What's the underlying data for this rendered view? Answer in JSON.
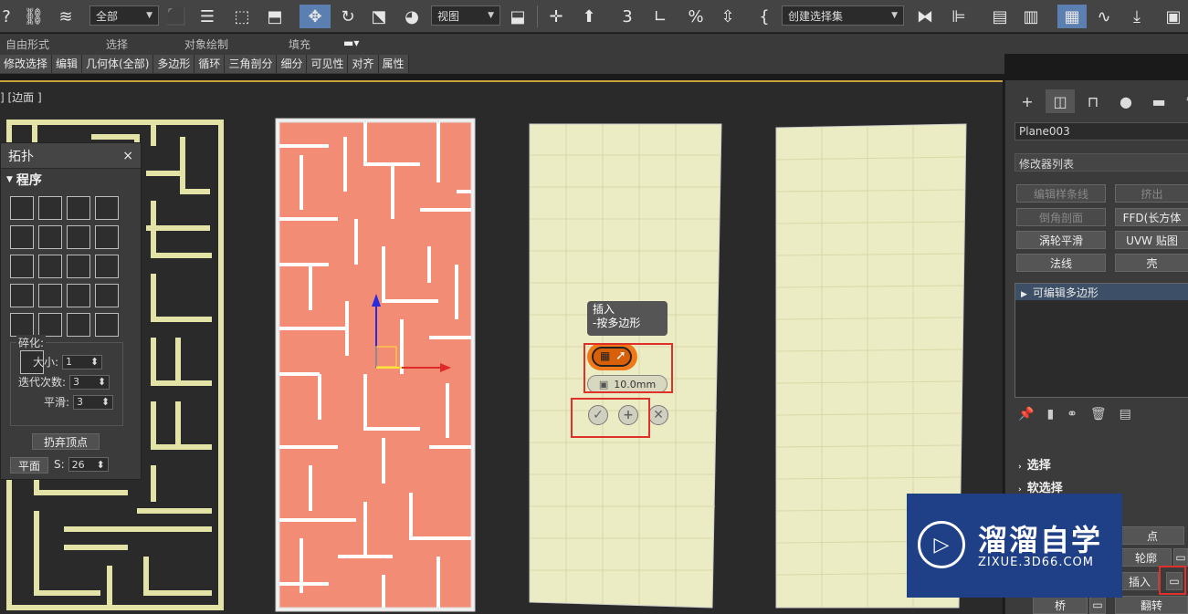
{
  "toolbar": {
    "selection_filter": "全部",
    "ref_coord": "视图",
    "named_selection": "创建选择集"
  },
  "ribbon": {
    "labels": [
      "自由形式",
      "选择",
      "对象绘制",
      "填充"
    ]
  },
  "subtabs": [
    "修改选择",
    "编辑",
    "几何体(全部)",
    "多边形",
    "循环",
    "三角剖分",
    "细分",
    "可见性",
    "对齐",
    "属性"
  ],
  "viewport": {
    "label": "] [边面 ]"
  },
  "topology": {
    "title": "拓扑",
    "close": "×",
    "section": "程序",
    "frag_title": "碎化:",
    "size_label": "大小:",
    "size_value": "1",
    "iter_label": "迭代次数:",
    "iter_value": "3",
    "smooth_label": "平滑:",
    "smooth_value": "3",
    "discard_button": "扔弃顶点",
    "plane_button": "平面",
    "s_label": "S:",
    "s_value": "26"
  },
  "caddy": {
    "line1": "插入",
    "line2": "-按多边形",
    "amount": "10.0mm"
  },
  "command_panel": {
    "object_name": "Plane003",
    "modifier_list": "修改器列表",
    "buttons": [
      "编辑样条线",
      "挤出",
      "倒角剖面",
      "FFD(长方体",
      "涡轮平滑",
      "UVW 贴图",
      "法线",
      "壳"
    ],
    "stack_item": "可编辑多边形",
    "rollouts": [
      "选择",
      "软选择"
    ],
    "edit_buttons": [
      "点",
      "轮廓",
      "插入",
      "桥",
      "翻转"
    ]
  },
  "watermark": {
    "title": "溜溜自学",
    "url": "ZIXUE.3D66.COM"
  },
  "colors": {
    "selected_polys": "#f28c74",
    "mesh_fill": "#ececc4",
    "highlight": "#e0302a",
    "caddy_orange": "#f07818"
  }
}
